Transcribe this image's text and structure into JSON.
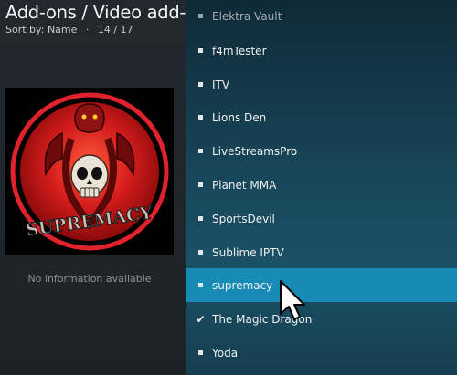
{
  "header": {
    "title": "Add-ons / Video add-ons",
    "sort_label": "Sort by: Name",
    "separator": "·",
    "count": "14 / 17"
  },
  "details": {
    "no_info": "No information available",
    "thumbnail_logo_text": "SUPREMACY"
  },
  "addons": [
    {
      "label": "Elektra Vault",
      "state": "dim"
    },
    {
      "label": "f4mTester",
      "state": "normal"
    },
    {
      "label": "ITV",
      "state": "normal"
    },
    {
      "label": "Lions Den",
      "state": "normal"
    },
    {
      "label": "LiveStreamsPro",
      "state": "normal"
    },
    {
      "label": "Planet MMA",
      "state": "normal"
    },
    {
      "label": "SportsDevil",
      "state": "normal"
    },
    {
      "label": "Sublime IPTV",
      "state": "normal"
    },
    {
      "label": "supremacy",
      "state": "selected"
    },
    {
      "label": "The Magic Dragon",
      "state": "checked"
    },
    {
      "label": "Yoda",
      "state": "normal"
    }
  ],
  "colors": {
    "selected_row": "#158bb6",
    "logo_ring": "#e0222c"
  },
  "icons": {
    "bullet": "square-bullet-icon",
    "checked": "checkmark-icon",
    "cursor": "mouse-pointer-icon"
  }
}
